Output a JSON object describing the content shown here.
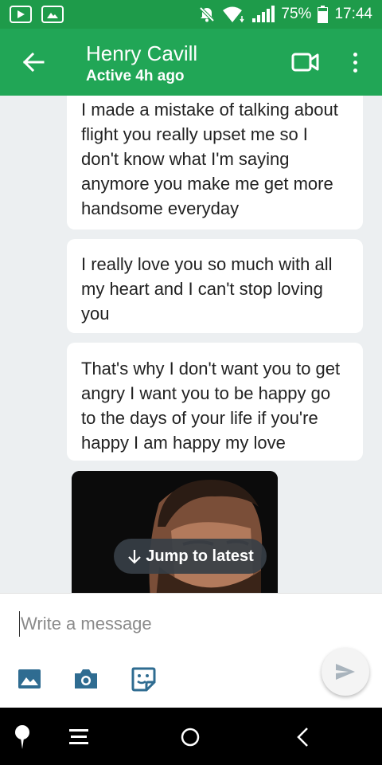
{
  "status_bar": {
    "battery": "75%",
    "time": "17:44",
    "icons": [
      "youtube-icon",
      "gallery-icon",
      "mute-icon",
      "wifi-icon",
      "signal-icon",
      "battery-icon"
    ]
  },
  "header": {
    "name": "Henry Cavill",
    "status": "Active 4h ago",
    "icons": [
      "back-arrow-icon",
      "video-call-icon",
      "more-vert-icon"
    ]
  },
  "messages": [
    "I made a mistake of talking about flight you really upset me so I don't know what I'm saying anymore you make me get more handsome everyday",
    "I really love you so much with all my heart and I can't stop loving you",
    "That's why I don't want you to get angry I want you to be happy go to the days of your life if you're happy I am happy my love"
  ],
  "jump_button": {
    "label": "Jump to latest",
    "icon": "arrow-down-icon"
  },
  "composer": {
    "placeholder": "Write a message",
    "value": "",
    "icons": [
      "image-icon",
      "camera-icon",
      "sticker-icon",
      "send-icon"
    ]
  },
  "nav_bar": {
    "icons": [
      "pin-icon",
      "menu-icon",
      "home-icon",
      "back-icon"
    ]
  },
  "colors": {
    "app_bar": "#21a656",
    "status_bar": "#1e9b4a",
    "chat_bg": "#eceff1",
    "icon_blue": "#2f6c91"
  }
}
